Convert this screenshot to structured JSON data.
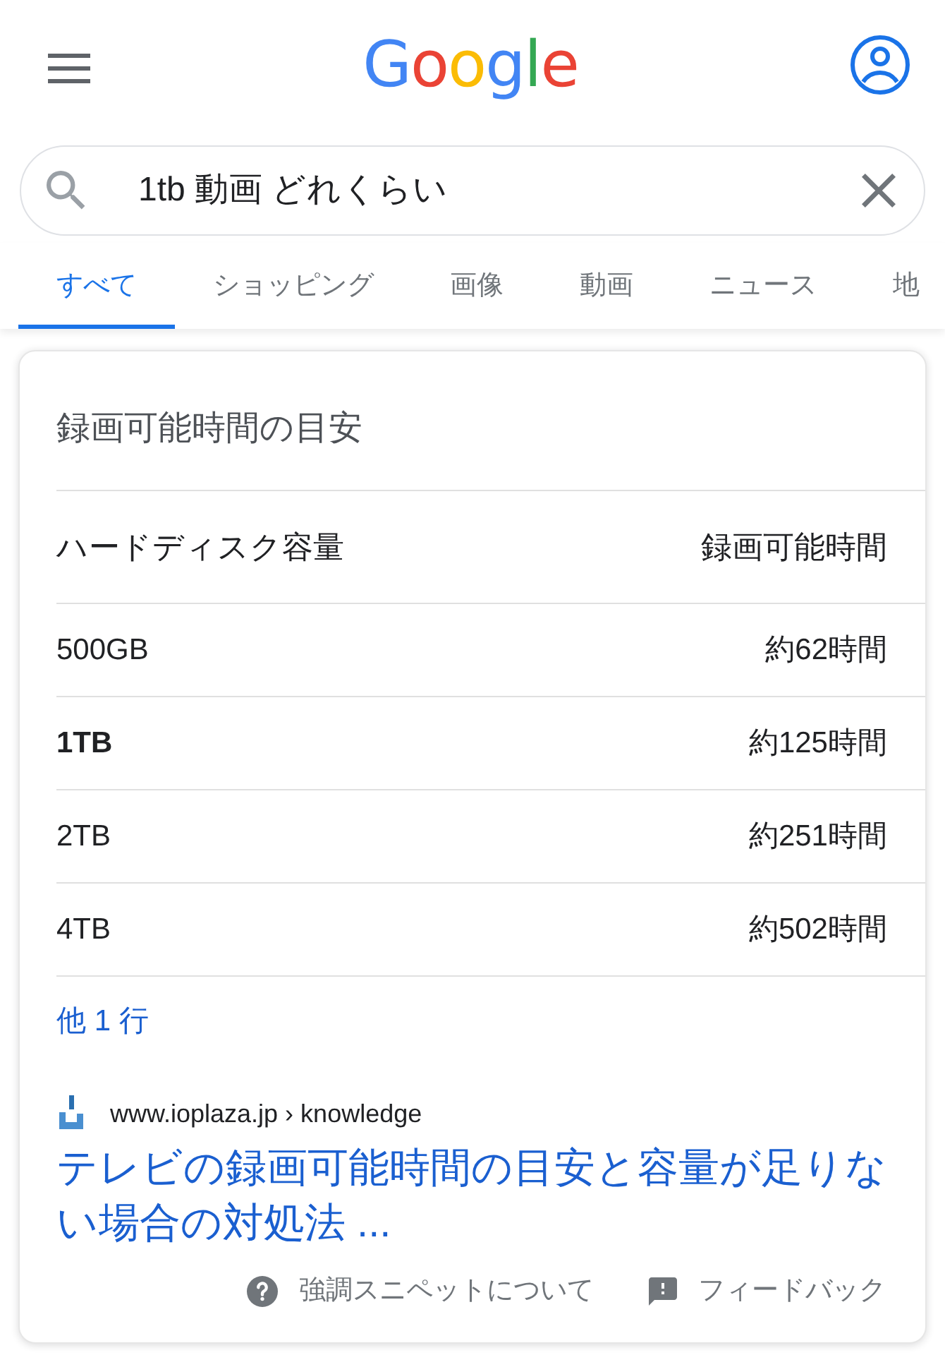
{
  "header": {
    "logo": "Google"
  },
  "search": {
    "value": "1tb 動画 どれくらい"
  },
  "tabs": [
    {
      "label": "すべて",
      "selected": true
    },
    {
      "label": "ショッピング",
      "selected": false
    },
    {
      "label": "画像",
      "selected": false
    },
    {
      "label": "動画",
      "selected": false
    },
    {
      "label": "ニュース",
      "selected": false
    },
    {
      "label": "地",
      "selected": false
    }
  ],
  "snippet": {
    "title": "録画可能時間の目安",
    "table": {
      "columns": [
        "ハードディスク容量",
        "録画可能時間"
      ],
      "rows": [
        {
          "capacity": "500GB",
          "time": "約62時間",
          "highlighted": false
        },
        {
          "capacity": "1TB",
          "time": "約125時間",
          "highlighted": true
        },
        {
          "capacity": "2TB",
          "time": "約251時間",
          "highlighted": false
        },
        {
          "capacity": "4TB",
          "time": "約502時間",
          "highlighted": false
        }
      ]
    },
    "more_rows": "他 1 行",
    "source": {
      "site": "www.ioplaza.jp › knowledge",
      "title": "テレビの録画可能時間の目安と容量が足りない場合の対処法 ..."
    },
    "footer": [
      {
        "kind": "about",
        "label": "強調スニペットについて"
      },
      {
        "kind": "feedback",
        "label": "フィードバック"
      }
    ]
  }
}
